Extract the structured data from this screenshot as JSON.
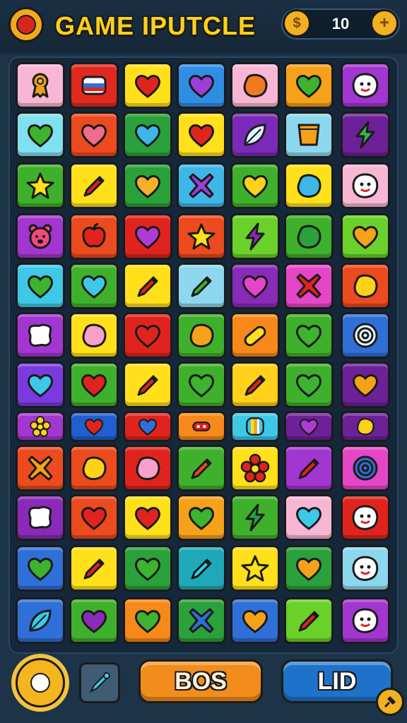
{
  "header": {
    "title": "GAME IPUTCLE",
    "coin_count": "10",
    "coin_icon": "coin-icon",
    "add_icon": "plus-icon",
    "logo_icon": "badge-icon"
  },
  "footer": {
    "left_icon": "sun-badge-icon",
    "tool_icon": "pencil-icon",
    "button_left_label": "BOS",
    "button_right_label": "LID",
    "corner_icon": "pin-icon"
  },
  "board": {
    "rows": [
      [
        {
          "bg": "#f7b7d4",
          "icon": "ribbon-icon",
          "color": "#e8a21c"
        },
        {
          "bg": "#e02a1f",
          "icon": "flag-icon",
          "color": "#ffffff"
        },
        {
          "bg": "#ffe01a",
          "icon": "heart-icon",
          "color": "#e0241d"
        },
        {
          "bg": "#2f8de4",
          "icon": "heart-icon",
          "color": "#9b3fd6"
        },
        {
          "bg": "#f7b7d4",
          "icon": "blob-icon",
          "color": "#ef7a22"
        },
        {
          "bg": "#f6a11a",
          "icon": "heart-icon",
          "color": "#3db330"
        },
        {
          "bg": "#a236d0",
          "icon": "face-icon",
          "color": "#ffffff"
        }
      ],
      [
        {
          "bg": "#7fe0f0",
          "icon": "heart-icon",
          "color": "#3db330"
        },
        {
          "bg": "#ec4a1f",
          "icon": "heart-icon",
          "color": "#f06c8c"
        },
        {
          "bg": "#2aa13a",
          "icon": "heart-icon",
          "color": "#3fb6e8"
        },
        {
          "bg": "#ffe01a",
          "icon": "heart-icon",
          "color": "#e0241d"
        },
        {
          "bg": "#7a2ab8",
          "icon": "leaf-icon",
          "color": "#dff2ff"
        },
        {
          "bg": "#8dd7ee",
          "icon": "cup-icon",
          "color": "#f6a11a"
        },
        {
          "bg": "#6c2198",
          "icon": "bolt-icon",
          "color": "#39b54a"
        }
      ],
      [
        {
          "bg": "#3fb02b",
          "icon": "star-icon",
          "color": "#ffe01a"
        },
        {
          "bg": "#ffe01a",
          "icon": "pencil-icon",
          "color": "#e0241d"
        },
        {
          "bg": "#2aa13a",
          "icon": "heart-icon",
          "color": "#f6b02a"
        },
        {
          "bg": "#3fb6e8",
          "icon": "cross-icon",
          "color": "#9b3fd6"
        },
        {
          "bg": "#3fb02b",
          "icon": "heart-icon",
          "color": "#ffd11a"
        },
        {
          "bg": "#ffe01a",
          "icon": "blob-icon",
          "color": "#3fb6e8"
        },
        {
          "bg": "#f7b7d4",
          "icon": "face-icon",
          "color": "#ffffff"
        }
      ],
      [
        {
          "bg": "#a236d0",
          "icon": "bear-icon",
          "color": "#ef4a7a"
        },
        {
          "bg": "#ec4a1f",
          "icon": "apple-icon",
          "color": "#e0241d"
        },
        {
          "bg": "#e0241d",
          "icon": "heart-icon",
          "color": "#b13ad6"
        },
        {
          "bg": "#ec4a1f",
          "icon": "star-icon",
          "color": "#ffe01a"
        },
        {
          "bg": "#6ad12a",
          "icon": "bolt-icon",
          "color": "#8a2ab8"
        },
        {
          "bg": "#3fb02b",
          "icon": "blob-icon",
          "color": "#2aa13a"
        },
        {
          "bg": "#6ad12a",
          "icon": "heart-icon",
          "color": "#f6a11a"
        }
      ],
      [
        {
          "bg": "#3ec8e8",
          "icon": "heart-icon",
          "color": "#3db330"
        },
        {
          "bg": "#3fb02b",
          "icon": "heart-icon",
          "color": "#3ec8e8"
        },
        {
          "bg": "#ffe01a",
          "icon": "pencil-icon",
          "color": "#e0241d"
        },
        {
          "bg": "#8dd7ee",
          "icon": "pencil-icon",
          "color": "#3db330"
        },
        {
          "bg": "#8a2ab8",
          "icon": "heart-icon",
          "color": "#e546c7"
        },
        {
          "bg": "#e546c7",
          "icon": "cross-icon",
          "color": "#e0241d"
        },
        {
          "bg": "#ec4a1f",
          "icon": "blob-icon",
          "color": "#ffd11a"
        }
      ],
      [
        {
          "bg": "#a236d0",
          "icon": "cloud-icon",
          "color": "#ffffff"
        },
        {
          "bg": "#ffe01a",
          "icon": "blob-icon",
          "color": "#f7a0c8"
        },
        {
          "bg": "#e0241d",
          "icon": "heart-icon",
          "color": "#e0241d"
        },
        {
          "bg": "#3fb02b",
          "icon": "blob-icon",
          "color": "#f6a11a"
        },
        {
          "bg": "#f6891a",
          "icon": "pill-icon",
          "color": "#ffe01a"
        },
        {
          "bg": "#3fb02b",
          "icon": "heart-icon",
          "color": "#3db330"
        },
        {
          "bg": "#2f6fd8",
          "icon": "spiral-icon",
          "color": "#e8f6ff"
        }
      ],
      [
        {
          "bg": "#7a3ae0",
          "icon": "heart-icon",
          "color": "#3ec8e8"
        },
        {
          "bg": "#3fb02b",
          "icon": "heart-icon",
          "color": "#e0241d"
        },
        {
          "bg": "#ffe01a",
          "icon": "pencil-icon",
          "color": "#e0241d"
        },
        {
          "bg": "#3fb02b",
          "icon": "heart-icon",
          "color": "#3db330"
        },
        {
          "bg": "#ffd11a",
          "icon": "pencil-icon",
          "color": "#e0241d"
        },
        {
          "bg": "#3fb02b",
          "icon": "heart-icon",
          "color": "#3db330"
        },
        {
          "bg": "#6c2198",
          "icon": "heart-icon",
          "color": "#f6a11a"
        }
      ],
      [
        {
          "bg": "#a236d0",
          "icon": "flower-icon",
          "color": "#ffd11a"
        },
        {
          "bg": "#1f5fd0",
          "icon": "heart-icon",
          "color": "#e0241d"
        },
        {
          "bg": "#e0241d",
          "icon": "heart-icon",
          "color": "#2f6fd8"
        },
        {
          "bg": "#f6891a",
          "icon": "candy-icon",
          "color": "#e0241d"
        },
        {
          "bg": "#3ec8e8",
          "icon": "stripe-icon",
          "color": "#f6a11a"
        },
        {
          "bg": "#6c2198",
          "icon": "heart-icon",
          "color": "#b13ad6"
        },
        {
          "bg": "#6c2198",
          "icon": "blob-icon",
          "color": "#ffd11a"
        }
      ],
      [
        {
          "bg": "#ec4a1f",
          "icon": "cross-icon",
          "color": "#f6a11a"
        },
        {
          "bg": "#ec4a1f",
          "icon": "blob-icon",
          "color": "#ffd11a"
        },
        {
          "bg": "#e0241d",
          "icon": "blob-icon",
          "color": "#f7a0c8"
        },
        {
          "bg": "#3fb02b",
          "icon": "pencil-icon",
          "color": "#ec4a1f"
        },
        {
          "bg": "#ffe01a",
          "icon": "flower-icon",
          "color": "#e0241d"
        },
        {
          "bg": "#a236d0",
          "icon": "pencil-icon",
          "color": "#e0241d"
        },
        {
          "bg": "#e546c7",
          "icon": "spiral-icon",
          "color": "#2f6fd8"
        }
      ],
      [
        {
          "bg": "#8a2ab8",
          "icon": "cloud-icon",
          "color": "#ffffff"
        },
        {
          "bg": "#ec4a1f",
          "icon": "heart-icon",
          "color": "#e0241d"
        },
        {
          "bg": "#ffe01a",
          "icon": "heart-icon",
          "color": "#e0241d"
        },
        {
          "bg": "#f6a11a",
          "icon": "heart-icon",
          "color": "#3db330"
        },
        {
          "bg": "#3fb02b",
          "icon": "bolt-icon",
          "color": "#2aa13a"
        },
        {
          "bg": "#f7b7d4",
          "icon": "heart-icon",
          "color": "#3ec8e8"
        },
        {
          "bg": "#e0241d",
          "icon": "face-icon",
          "color": "#ffffff"
        }
      ],
      [
        {
          "bg": "#2f6fd8",
          "icon": "heart-icon",
          "color": "#3db330"
        },
        {
          "bg": "#ffe01a",
          "icon": "pencil-icon",
          "color": "#e0241d"
        },
        {
          "bg": "#2aa13a",
          "icon": "heart-icon",
          "color": "#3db330"
        },
        {
          "bg": "#1fa8b8",
          "icon": "pencil-icon",
          "color": "#3ec8e8"
        },
        {
          "bg": "#ffe01a",
          "icon": "star-icon",
          "color": "#ffe01a"
        },
        {
          "bg": "#2aa13a",
          "icon": "heart-icon",
          "color": "#f6a11a"
        },
        {
          "bg": "#8dd7ee",
          "icon": "face-icon",
          "color": "#ffffff"
        }
      ],
      [
        {
          "bg": "#2f6fd8",
          "icon": "leaf-icon",
          "color": "#3ec8e8"
        },
        {
          "bg": "#3fb02b",
          "icon": "heart-icon",
          "color": "#8a2ab8"
        },
        {
          "bg": "#f6891a",
          "icon": "heart-icon",
          "color": "#3db330"
        },
        {
          "bg": "#2aa13a",
          "icon": "cross-icon",
          "color": "#2f6fd8"
        },
        {
          "bg": "#2f6fd8",
          "icon": "heart-icon",
          "color": "#f6a11a"
        },
        {
          "bg": "#6ad12a",
          "icon": "pencil-icon",
          "color": "#e0241d"
        },
        {
          "bg": "#a236d0",
          "icon": "face-icon",
          "color": "#ffffff"
        }
      ]
    ]
  }
}
